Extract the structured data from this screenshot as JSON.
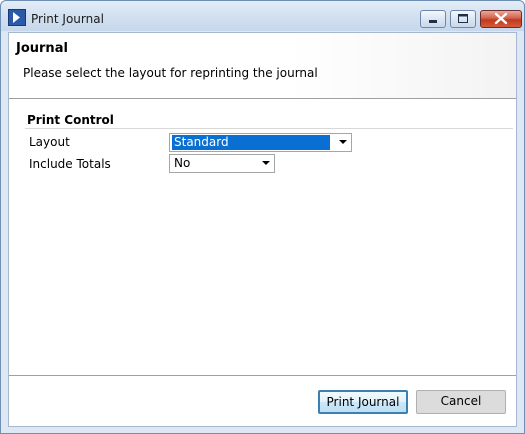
{
  "window": {
    "title": "Print Journal",
    "controls": {
      "minimize": "minimize",
      "maximize": "maximize",
      "close": "close"
    }
  },
  "header": {
    "title": "Journal",
    "description": "Please select the layout for reprinting the journal"
  },
  "print_control": {
    "section_title": "Print Control",
    "layout": {
      "label": "Layout",
      "selected": "Standard"
    },
    "include_totals": {
      "label": "Include Totals",
      "selected": "No"
    }
  },
  "buttons": {
    "print_label": "Print Journal",
    "cancel_label": "Cancel"
  },
  "colors": {
    "selection": "#0a6fd2",
    "default_button_border": "#3c7fb1",
    "close_button": "#c0391d"
  },
  "icons": [
    "app-icon",
    "minimize-icon",
    "maximize-icon",
    "close-icon",
    "chevron-down-icon"
  ]
}
